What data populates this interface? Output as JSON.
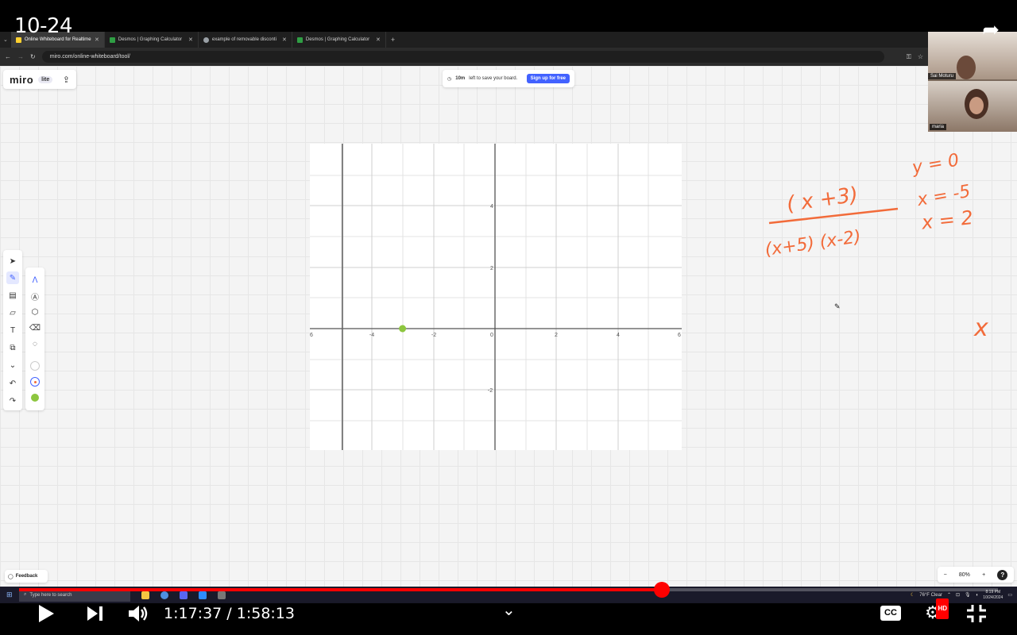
{
  "video": {
    "title": "10-24",
    "share_icon": "share-arrow-icon"
  },
  "browser": {
    "tabs": [
      {
        "label": "Online Whiteboard for Realtime",
        "favicon_color": "#ffd02f",
        "active": true
      },
      {
        "label": "Desmos | Graphing Calculator",
        "favicon_color": "#2f9e44",
        "active": false
      },
      {
        "label": "example of removable disconti",
        "favicon_color": "#9aa0a6",
        "active": false
      },
      {
        "label": "Desmos | Graphing Calculator",
        "favicon_color": "#2f9e44",
        "active": false
      }
    ],
    "url": "miro.com/online-whiteboard/tool/"
  },
  "miro": {
    "logo": "miro",
    "badge": "lite",
    "banner": {
      "time": "10m",
      "text": "left to save your board.",
      "button": "Sign up for free"
    },
    "feedback": "Feedback",
    "zoom": "80%",
    "help": "?"
  },
  "graph": {
    "x_ticks": [
      "6",
      "-4",
      "-2",
      "0",
      "2",
      "4",
      "6"
    ],
    "y_ticks": [
      "4",
      "2",
      "-2"
    ],
    "point": {
      "x": -3,
      "y": 0,
      "color": "#8dc63f"
    }
  },
  "handwriting": {
    "numerator": "( x +3)",
    "denominator": "(x+5) (x-2)",
    "eq1": "y = 0",
    "eq2": "x = -5",
    "eq3": "x = 2",
    "partial": "x",
    "color": "#f26b3a"
  },
  "webcam": [
    {
      "name": "Sai Moturu"
    },
    {
      "name": "maria"
    }
  ],
  "taskbar": {
    "search_placeholder": "Type here to search",
    "weather": "76°F  Clear",
    "time": "8:19 PM",
    "date": "10/24/2024"
  },
  "player": {
    "current_time": "1:17:37",
    "separator": " / ",
    "duration": "1:58:13",
    "progress_fraction": 0.657,
    "hd_badge": "HD",
    "cc_label": "CC"
  }
}
